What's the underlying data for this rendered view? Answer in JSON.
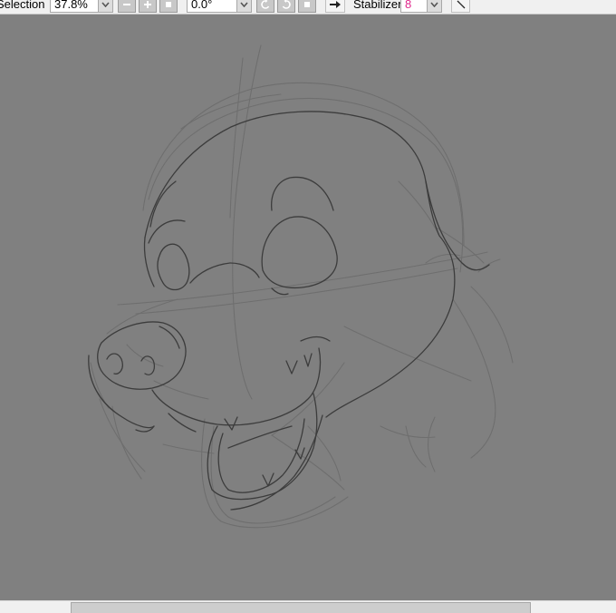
{
  "toolbar": {
    "selection_label": "Selection",
    "zoom_value": "37.8%",
    "rotation_value": "0.0°",
    "stabilizer_label": "Stabilizer",
    "stabilizer_value": "8"
  },
  "icons": {
    "zoom_dropdown": "chevron-down-icon",
    "zoom_out": "minus-icon",
    "zoom_in": "plus-icon",
    "zoom_reset": "square-icon",
    "rotation_dropdown": "chevron-down-icon",
    "rotate_left": "rotate-left-icon",
    "rotate_right": "rotate-right-icon",
    "rotation_reset": "square-icon",
    "flip_horizontal": "flip-arrow-icon",
    "stabilizer_dropdown": "chevron-down-icon",
    "pen_tool": "pen-icon"
  },
  "colors": {
    "canvas_background": "#808080",
    "toolbar_background": "#f0f0f0",
    "stabilizer_value": "#e0288c",
    "sketch_line": "#3c3c3c"
  }
}
